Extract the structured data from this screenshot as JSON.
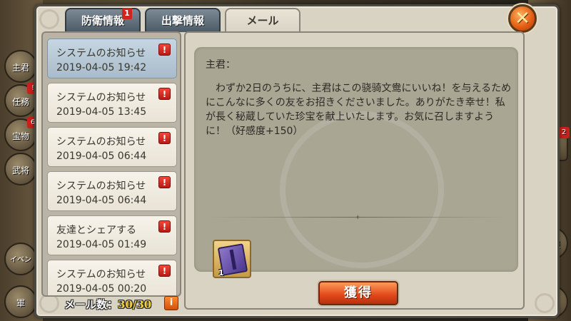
{
  "tabs": [
    {
      "label": "防衛情報",
      "badge": "1"
    },
    {
      "label": "出撃情報",
      "badge": ""
    },
    {
      "label": "メール",
      "badge": ""
    }
  ],
  "mail_list": [
    {
      "title": "システムのお知らせ",
      "date": "2019-04-05 19:42",
      "selected": true
    },
    {
      "title": "システムのお知らせ",
      "date": "2019-04-05 13:45",
      "selected": false
    },
    {
      "title": "システムのお知らせ",
      "date": "2019-04-05 06:44",
      "selected": false
    },
    {
      "title": "システムのお知らせ",
      "date": "2019-04-05 06:44",
      "selected": false
    },
    {
      "title": "友達とシェアする",
      "date": "2019-04-05 01:49",
      "selected": false
    },
    {
      "title": "システムのお知らせ",
      "date": "2019-04-05 00:20",
      "selected": false
    }
  ],
  "unread_mark": "!",
  "mail_count": {
    "label": "メール数：",
    "value": "30/30"
  },
  "info_button": "i",
  "message": {
    "greeting": "主君：",
    "body": "わずか2日のうちに、主君はこの骁骑文鸯にいいね！を与えるためにこんなに多くの友をお招きくださいました。ありがたき幸せ！私が長く秘蔵していた珍宝を献上いたします。お気に召しますように！（好感度+150）"
  },
  "attachment": {
    "icon": "book-icon",
    "quantity": "1"
  },
  "claim_button": "獲得",
  "close_icon": "close-icon",
  "background_buttons": {
    "left": [
      {
        "label": "主君",
        "badge": ""
      },
      {
        "label": "任務",
        "badge": "!"
      },
      {
        "label": "宝物",
        "badge": "6"
      },
      {
        "label": "武将",
        "badge": ""
      },
      {
        "label": "イベン",
        "badge": ""
      },
      {
        "label": "軍",
        "badge": ""
      }
    ],
    "right": [
      {
        "label": "",
        "badge": "2"
      },
      {
        "label": "情報",
        "badge": ""
      },
      {
        "label": "政",
        "badge": ""
      }
    ]
  }
}
